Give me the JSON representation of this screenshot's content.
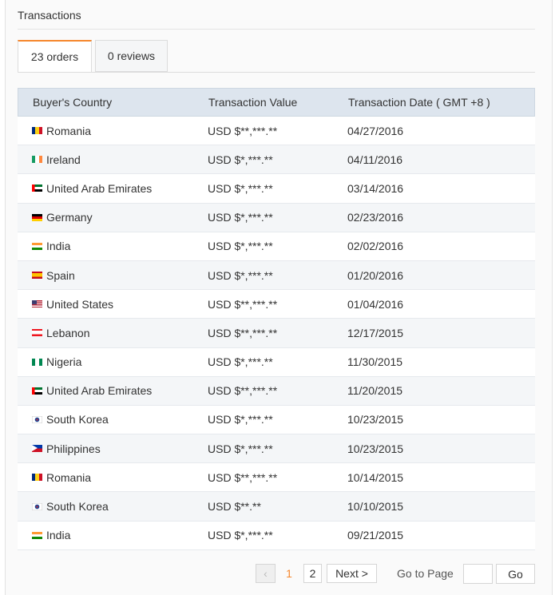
{
  "section_title": "Transactions",
  "tabs": [
    {
      "label": "23 orders",
      "active": true
    },
    {
      "label": "0 reviews",
      "active": false
    }
  ],
  "table": {
    "headers": [
      "Buyer's Country",
      "Transaction Value",
      "Transaction Date ( GMT +8 )"
    ],
    "rows": [
      {
        "flag": "romania-flag",
        "country": "Romania",
        "value": "USD $**,***.**",
        "date": "04/27/2016"
      },
      {
        "flag": "ireland-flag",
        "country": "Ireland",
        "value": "USD $*,***.**",
        "date": "04/11/2016"
      },
      {
        "flag": "uae-flag",
        "country": "United Arab Emirates",
        "value": "USD $*,***.**",
        "date": "03/14/2016"
      },
      {
        "flag": "germany-flag",
        "country": "Germany",
        "value": "USD $*,***.**",
        "date": "02/23/2016"
      },
      {
        "flag": "india-flag",
        "country": "India",
        "value": "USD $*,***.**",
        "date": "02/02/2016"
      },
      {
        "flag": "spain-flag",
        "country": "Spain",
        "value": "USD $*,***.**",
        "date": "01/20/2016"
      },
      {
        "flag": "usa-flag",
        "country": "United States",
        "value": "USD $**,***.**",
        "date": "01/04/2016"
      },
      {
        "flag": "lebanon-flag",
        "country": "Lebanon",
        "value": "USD $**,***.**",
        "date": "12/17/2015"
      },
      {
        "flag": "nigeria-flag",
        "country": "Nigeria",
        "value": "USD $*,***.**",
        "date": "11/30/2015"
      },
      {
        "flag": "uae-flag",
        "country": "United Arab Emirates",
        "value": "USD $**,***.**",
        "date": "11/20/2015"
      },
      {
        "flag": "south-korea-flag",
        "country": "South Korea",
        "value": "USD $*,***.**",
        "date": "10/23/2015"
      },
      {
        "flag": "philippines-flag",
        "country": "Philippines",
        "value": "USD $*,***.**",
        "date": "10/23/2015"
      },
      {
        "flag": "romania-flag",
        "country": "Romania",
        "value": "USD $**,***.**",
        "date": "10/14/2015"
      },
      {
        "flag": "south-korea-flag",
        "country": "South Korea",
        "value": "USD $**.**",
        "date": "10/10/2015"
      },
      {
        "flag": "india-flag",
        "country": "India",
        "value": "USD $*,***.**",
        "date": "09/21/2015"
      }
    ]
  },
  "pagination": {
    "prev_icon": "chevron-left-icon",
    "pages": [
      "1",
      "2"
    ],
    "current_page": "1",
    "next_label": "Next >",
    "goto_label": "Go to Page",
    "goto_value": "",
    "go_label": "Go"
  },
  "colors": {
    "accent": "#f6872c",
    "header_bg": "#dde5ee"
  }
}
